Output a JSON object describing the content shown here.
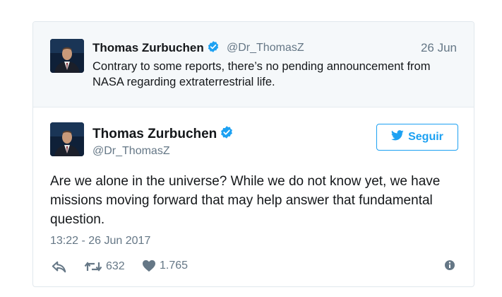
{
  "quoted_tweet": {
    "author_name": "Thomas Zurbuchen",
    "handle": "@Dr_ThomasZ",
    "date": "26 Jun",
    "text": "Contrary to some reports, there’s no pending announcement from NASA regarding extraterrestrial life."
  },
  "tweet": {
    "author_name": "Thomas Zurbuchen",
    "handle": "@Dr_ThomasZ",
    "follow_label": "Seguir",
    "text": "Are we alone in the universe? While we do not know yet, we have missions moving forward that may help answer that fundamental question.",
    "timestamp": "13:22 - 26 Jun 2017",
    "retweet_count": "632",
    "like_count": "1.765"
  },
  "colors": {
    "accent": "#1da1f2",
    "secondary_text": "#657786",
    "parent_background": "#f5f8fa"
  },
  "icons": {
    "verified": "verified-badge-icon",
    "bird": "twitter-bird-icon",
    "reply": "reply-icon",
    "retweet": "retweet-icon",
    "like": "heart-icon",
    "info": "info-icon"
  }
}
